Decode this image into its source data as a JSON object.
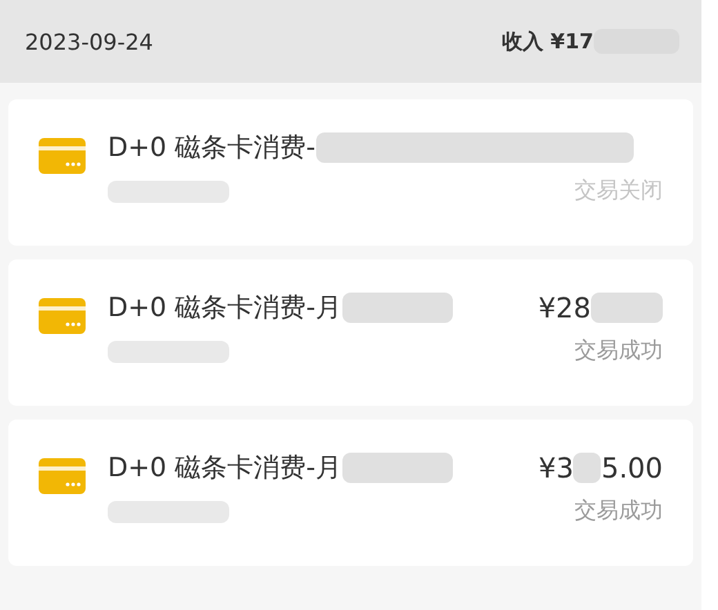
{
  "header": {
    "date": "2023-09-24",
    "income": "收入 ¥17"
  },
  "transactions": [
    {
      "title": "D+0 磁条卡消费-",
      "status": "交易关闭",
      "closed": true
    },
    {
      "title": "D+0 磁条卡消费-月",
      "amount_start": "¥28",
      "status": "交易成功",
      "closed": false
    },
    {
      "title": "D+0 磁条卡消费-月",
      "amount_start": "¥3",
      "amount_end": "5.00",
      "status": "交易成功",
      "closed": false
    }
  ]
}
